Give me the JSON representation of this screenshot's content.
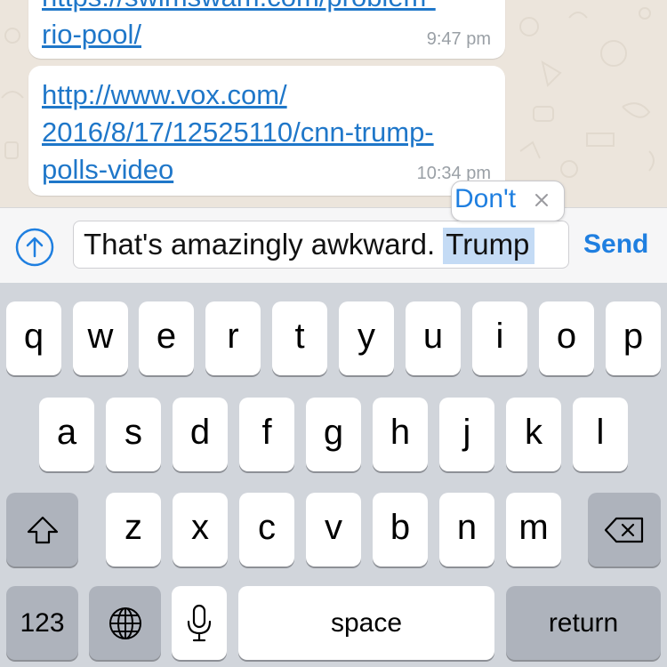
{
  "colors": {
    "chat_background": "#ece5dc",
    "link": "#1f77c9",
    "accent": "#1f7fe0",
    "selection": "#c4dbf5",
    "keyboard_background": "#d1d5db",
    "dark_key": "#aeb3bc"
  },
  "messages": [
    {
      "link_lines": [
        "https://swimswam.com/problem-",
        "rio-pool/"
      ],
      "time": "9:47 pm"
    },
    {
      "link_lines": [
        "http://www.vox.com/",
        "2016/8/17/12525110/cnn-trump-",
        "polls-video"
      ],
      "time": "10:34 pm"
    }
  ],
  "input": {
    "text_before": "That's amazingly awkward. ",
    "selected_word": "Trump",
    "send_label": "Send"
  },
  "autocorrect": {
    "suggestion": "Don't",
    "close_icon": "close-x-icon"
  },
  "keyboard": {
    "row1": [
      "q",
      "w",
      "e",
      "r",
      "t",
      "y",
      "u",
      "i",
      "o",
      "p"
    ],
    "row2": [
      "a",
      "s",
      "d",
      "f",
      "g",
      "h",
      "j",
      "k",
      "l"
    ],
    "row3": [
      "z",
      "x",
      "c",
      "v",
      "b",
      "n",
      "m"
    ],
    "shift_icon": "shift-arrow-icon",
    "delete_icon": "backspace-icon",
    "numbers_label": "123",
    "globe_icon": "globe-icon",
    "mic_icon": "microphone-icon",
    "space_label": "space",
    "return_label": "return"
  }
}
